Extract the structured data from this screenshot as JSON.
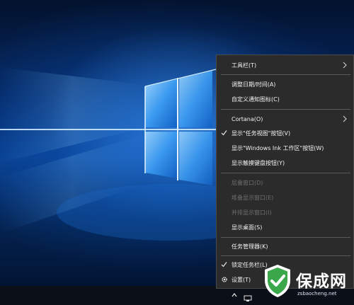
{
  "context_menu": {
    "items": [
      {
        "label": "工具栏(T)",
        "submenu": true
      },
      {
        "label": "调整日期/时间(A)"
      },
      {
        "label": "自定义通知图标(C)"
      },
      {
        "label": "Cortana(O)",
        "submenu": true
      },
      {
        "label": "显示\"任务视图\"按钮(V)",
        "checked": true
      },
      {
        "label": "显示\"Windows Ink 工作区\"按钮(W)"
      },
      {
        "label": "显示触摸键盘按钮(Y)"
      },
      {
        "label": "层叠窗口(D)",
        "disabled": true
      },
      {
        "label": "堆叠显示窗口(E)",
        "disabled": true
      },
      {
        "label": "并排显示窗口(I)",
        "disabled": true
      },
      {
        "label": "显示桌面(S)"
      },
      {
        "label": "任务管理器(K)"
      },
      {
        "label": "锁定任务栏(L)",
        "checked": true
      },
      {
        "label": "设置(T)",
        "icon": "gear-icon"
      }
    ]
  },
  "taskbar": {
    "tray_chevron_icon": "chevron-up-icon",
    "tray_icon": "network-icon"
  },
  "watermark": {
    "title": "保成网",
    "url": "zsbaocheng.net",
    "logo_icon": "shield-check-logo"
  },
  "colors": {
    "menu_bg": "#2b2b2b",
    "menu_text": "#f2f2f2",
    "menu_disabled_text": "#6e6e6e",
    "taskbar_bg": "#0b0f17",
    "wallpaper_accent": "#1e7be0",
    "logo_green": "#3aa84a"
  }
}
